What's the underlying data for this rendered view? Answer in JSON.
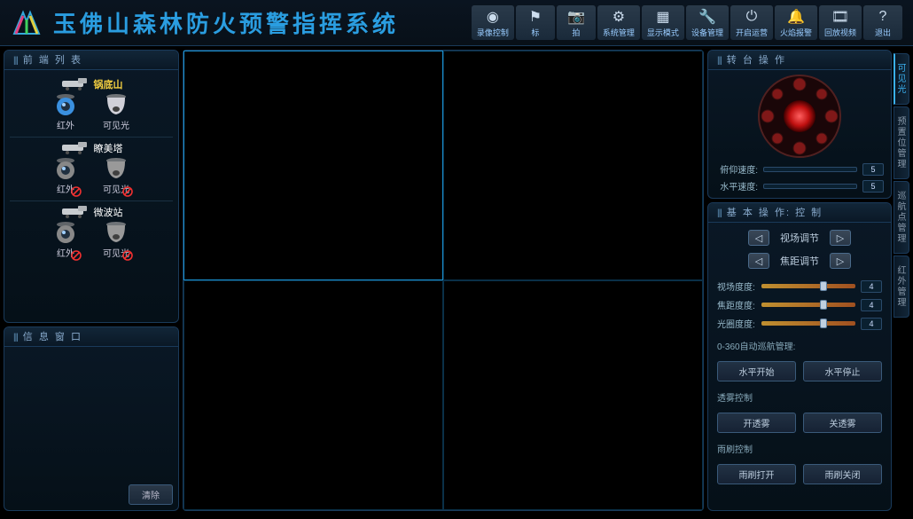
{
  "title": "玉佛山森林防火预警指挥系统",
  "topButtons": [
    {
      "label": "录像控制"
    },
    {
      "label": "标"
    },
    {
      "label": "拍"
    },
    {
      "label": "系统管理"
    },
    {
      "label": "显示模式"
    },
    {
      "label": "设备管理"
    },
    {
      "label": "开启运营"
    },
    {
      "label": "火焰报警"
    },
    {
      "label": "回放视频"
    },
    {
      "label": "退出"
    }
  ],
  "topIcons": [
    "globe",
    "flag",
    "camera",
    "gear",
    "grid",
    "wrench",
    "open",
    "siren",
    "film",
    "question"
  ],
  "left": {
    "deviceListTitle": "前 端 列 表",
    "infoTitle": "信 息 窗 口",
    "clear": "清除",
    "devices": [
      {
        "name": "锅底山",
        "active": true,
        "ir": "红外",
        "vis": "可见光",
        "offline": false
      },
      {
        "name": "瞭美塔",
        "active": false,
        "ir": "红外",
        "vis": "可见光",
        "offline": true
      },
      {
        "name": "微波站",
        "active": false,
        "ir": "红外",
        "vis": "可见光",
        "offline": true
      }
    ]
  },
  "right": {
    "ptzTitle": "转 台 操 作",
    "basicTitle": "基 本 操 作: 控 制",
    "tiltSpeedLabel": "俯仰速度:",
    "panSpeedLabel": "水平速度:",
    "tiltSpeed": "5",
    "panSpeed": "5",
    "adjust": [
      {
        "label": "视场调节"
      },
      {
        "label": "焦距调节"
      }
    ],
    "sliders": [
      {
        "label": "视场度度:",
        "val": "4",
        "pos": 62
      },
      {
        "label": "焦距度度:",
        "val": "4",
        "pos": 62
      },
      {
        "label": "光圈度度:",
        "val": "4",
        "pos": 62
      }
    ],
    "sections": [
      {
        "title": "0-360自动巡航管理:",
        "btns": [
          "水平开始",
          "水平停止"
        ]
      },
      {
        "title": "透雾控制",
        "btns": [
          "开透雾",
          "关透雾"
        ]
      },
      {
        "title": "雨刷控制",
        "btns": [
          "雨刷打开",
          "雨刷关闭"
        ]
      }
    ],
    "tabs": [
      "可见光",
      "预置位管理",
      "巡航点管理",
      "红外管理"
    ]
  }
}
